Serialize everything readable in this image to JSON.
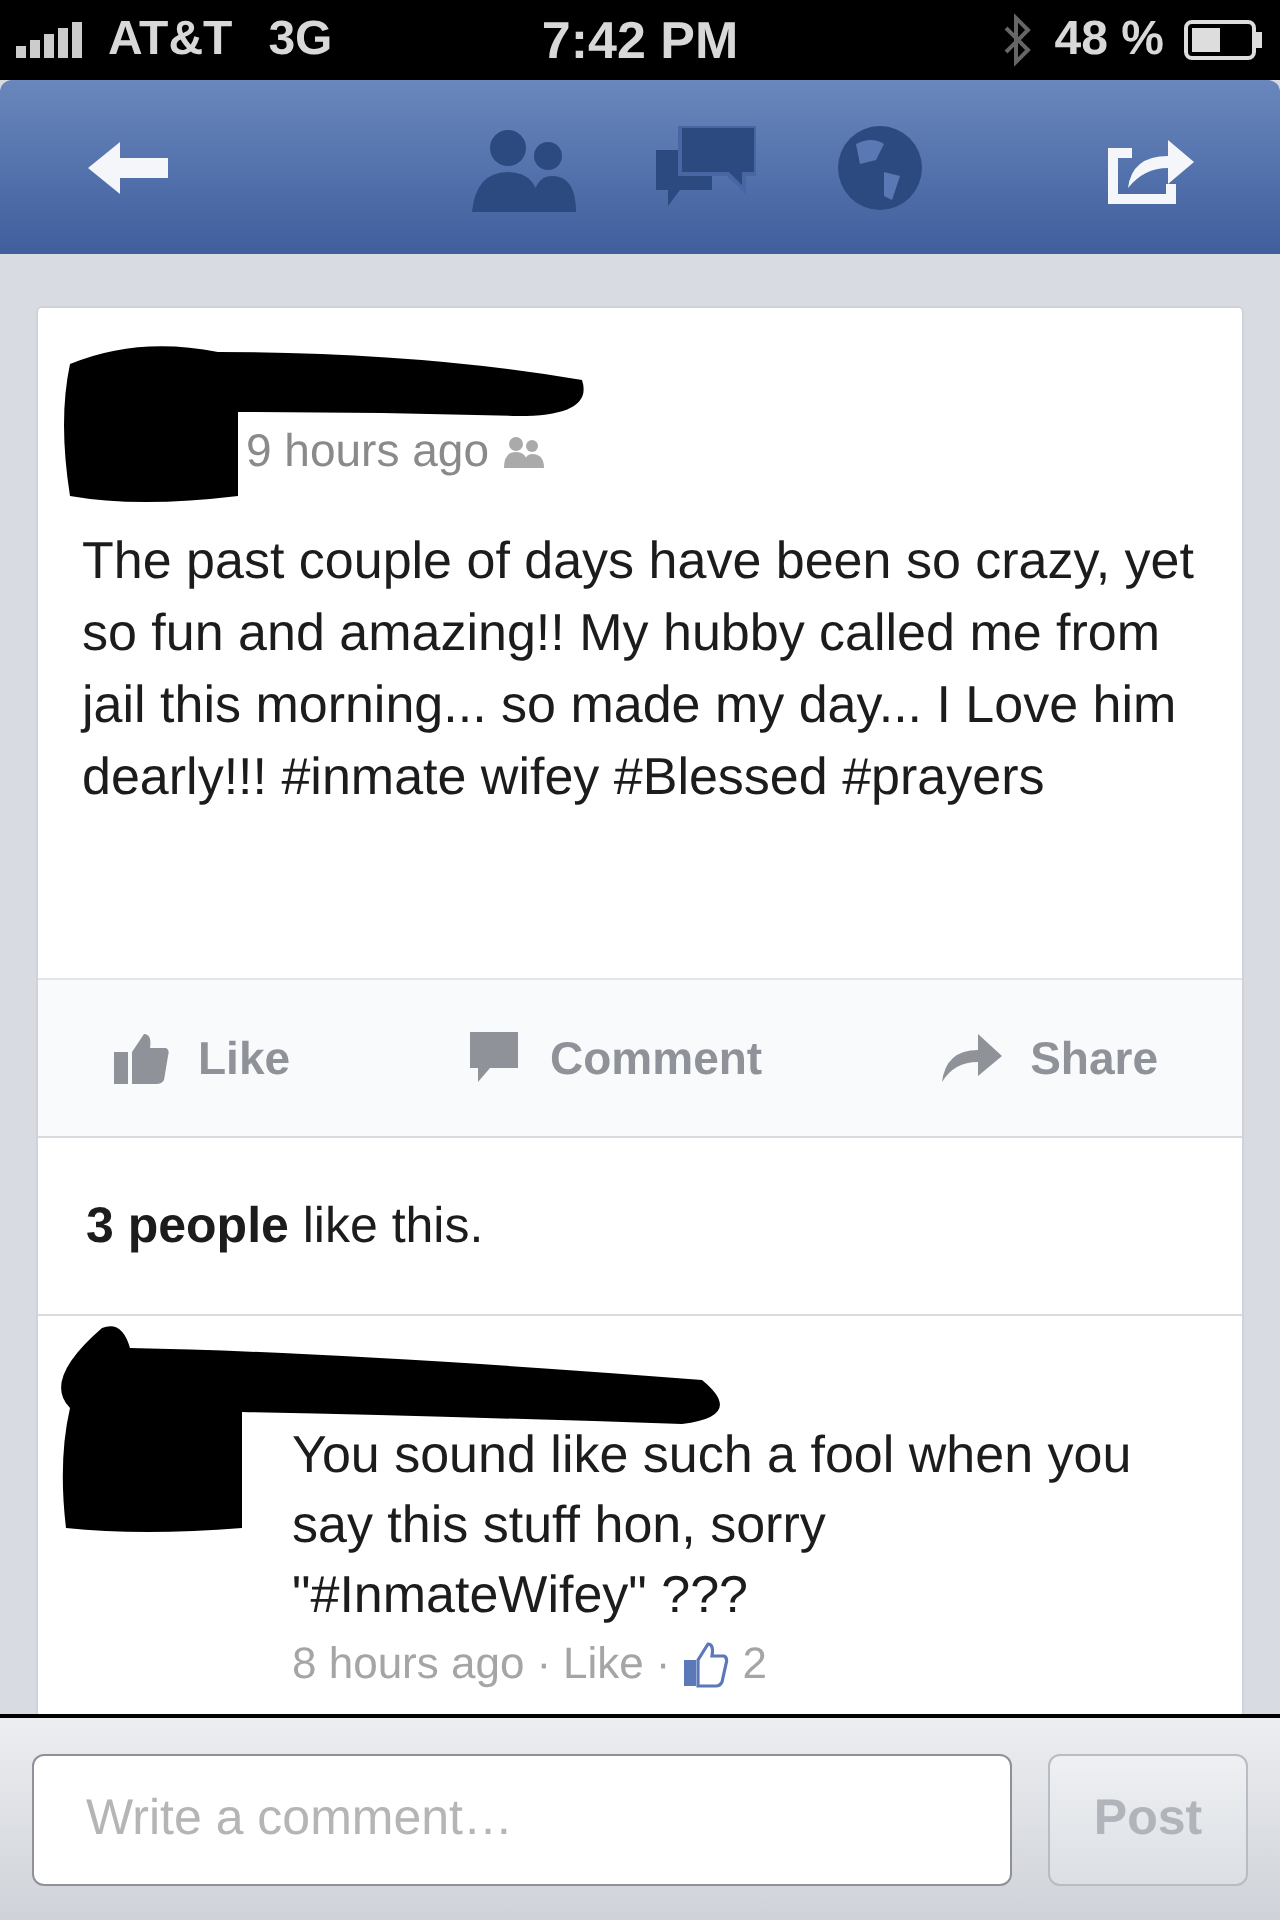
{
  "status_bar": {
    "carrier": "AT&T",
    "network": "3G",
    "time": "7:42 PM",
    "battery": "48 %"
  },
  "post": {
    "time": "9 hours ago",
    "text": "The past couple of days have been so crazy, yet so fun and amazing!! My hubby called me from jail this morning... so made my day... I Love him dearly!!! #inmate wifey #Blessed #prayers",
    "actions": [
      {
        "kind": "like",
        "label": "Like"
      },
      {
        "kind": "comment",
        "label": "Comment"
      },
      {
        "kind": "share",
        "label": "Share"
      }
    ],
    "likes_summary": "**3 people** like this."
  },
  "comments": [
    {
      "text": "You sound like such a fool when you say this stuff hon, sorry \"#InmateWifey\" ???",
      "time": "8 hours ago",
      "separator_1": "·",
      "like_link": "Like",
      "separator_2": "·",
      "like_count": "2"
    }
  ],
  "composer": {
    "placeholder": "Write a comment…",
    "post_button": {
      "label": "Post",
      "disabled": true
    }
  }
}
